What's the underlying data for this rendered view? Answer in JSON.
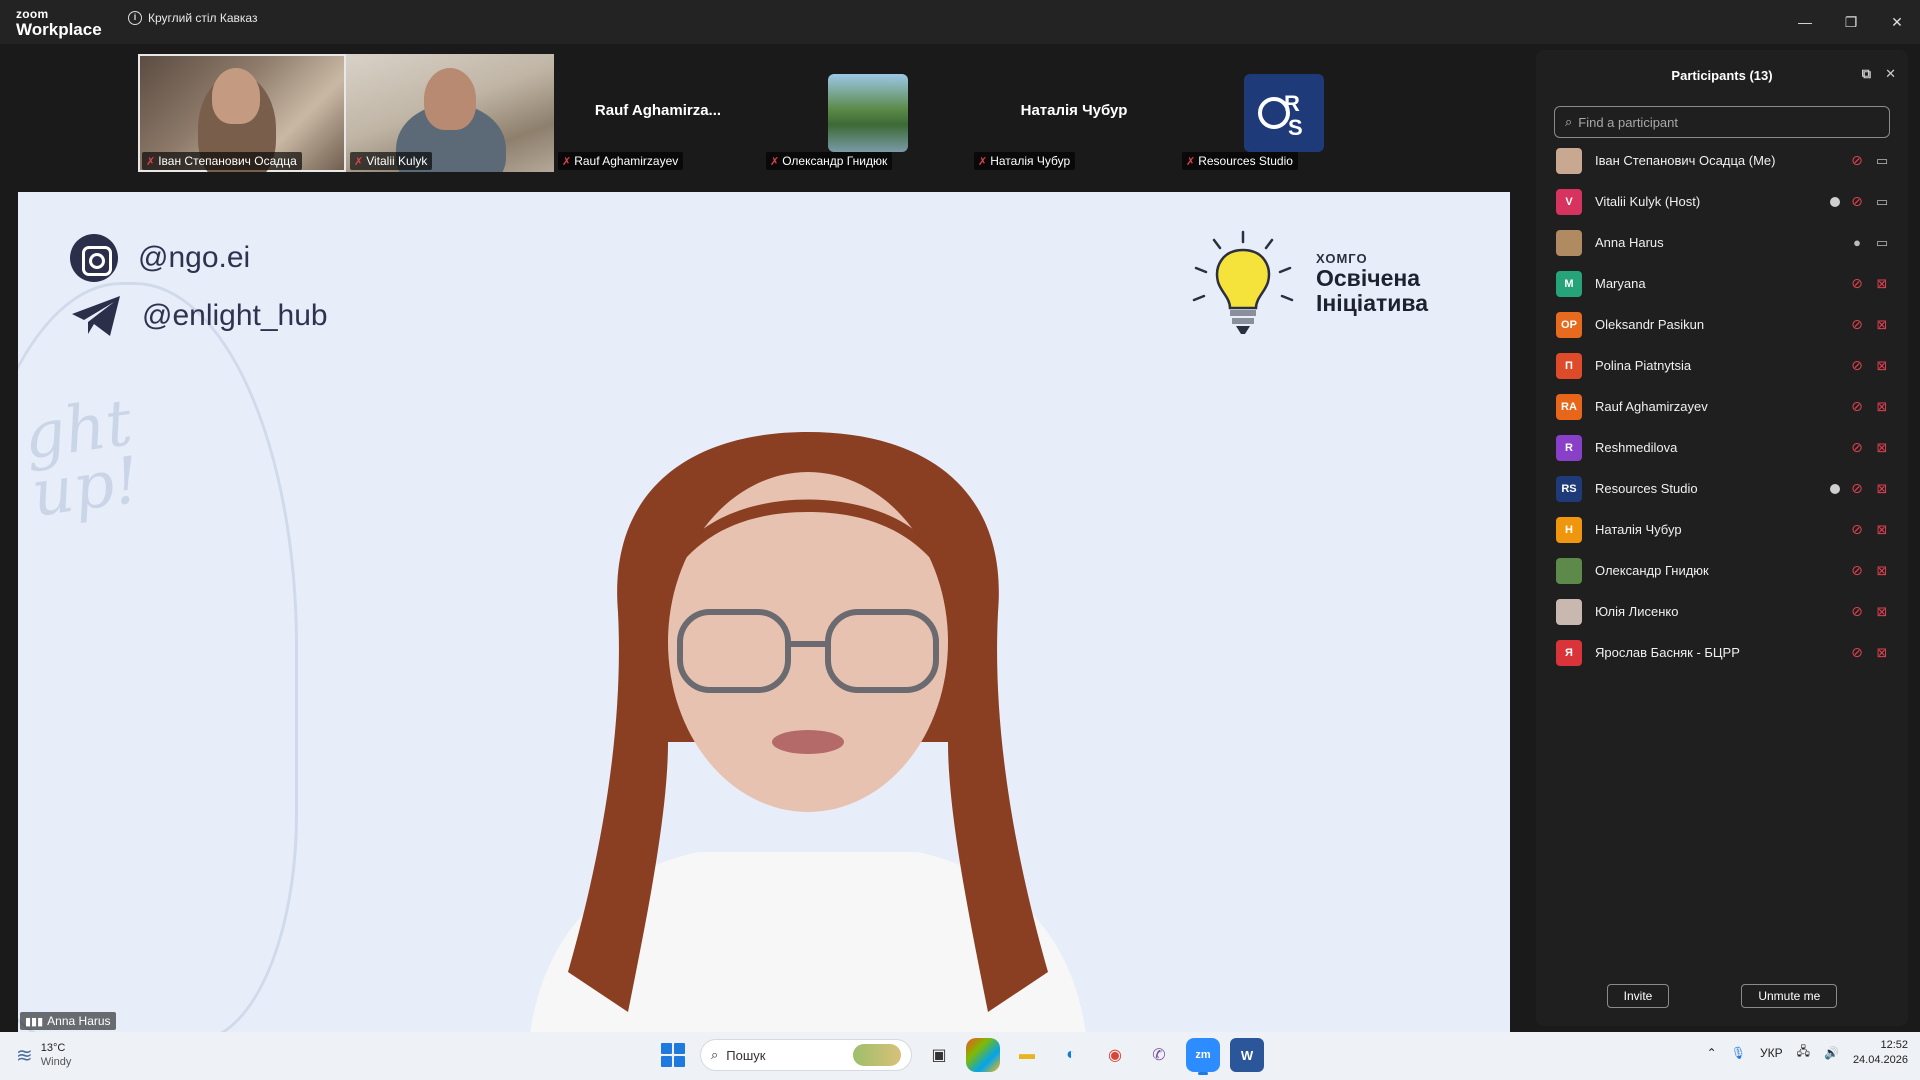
{
  "app": {
    "brand_top": "zoom",
    "brand_bottom": "Workplace",
    "meeting_title": "Круглий стіл Кавказ"
  },
  "window_controls": {
    "minimize": "—",
    "restore": "❐",
    "close": "✕"
  },
  "thumbnails": [
    {
      "name": "Іван Степанович Осадца",
      "type": "video"
    },
    {
      "name": "Vitalii Kulyk",
      "type": "video"
    },
    {
      "name": "Rauf Aghamirzayev",
      "display": "Rauf Aghamirza...",
      "type": "name"
    },
    {
      "name": "Олександр Гнидюк",
      "type": "avatar"
    },
    {
      "name": "Наталія Чубур",
      "display": "Наталія Чубур",
      "type": "name"
    },
    {
      "name": "Resources Studio",
      "type": "logo"
    }
  ],
  "main_video": {
    "instagram": "@ngo.ei",
    "telegram": "@enlight_hub",
    "logo_small": "ХОМГО",
    "logo_line1": "Освічена",
    "logo_line2": "Ініціатива",
    "bulb_text_1": "ght",
    "bulb_text_2": "up!",
    "speaker_name": "Anna Harus"
  },
  "panel": {
    "title": "Participants (13)",
    "search_placeholder": "Find a participant",
    "participants": [
      {
        "name": "Іван Степанович Осадца (Me)",
        "initials": "",
        "color": "#c8a890",
        "dot": false,
        "mic": "off",
        "cam": "on"
      },
      {
        "name": "Vitalii Kulyk (Host)",
        "initials": "V",
        "color": "#d6335e",
        "dot": true,
        "mic": "off",
        "cam": "on"
      },
      {
        "name": "Anna Harus",
        "initials": "",
        "color": "#b08a60",
        "dot": false,
        "mic": "on",
        "cam": "on"
      },
      {
        "name": "Maryana",
        "initials": "M",
        "color": "#27a37a",
        "dot": false,
        "mic": "off",
        "cam": "off"
      },
      {
        "name": "Oleksandr Pasikun",
        "initials": "OP",
        "color": "#e86a1e",
        "dot": false,
        "mic": "off",
        "cam": "off"
      },
      {
        "name": "Polina Piatnytsia",
        "initials": "П",
        "color": "#dd4b2a",
        "dot": false,
        "mic": "off",
        "cam": "off"
      },
      {
        "name": "Rauf Aghamirzayev",
        "initials": "RA",
        "color": "#e8661a",
        "dot": false,
        "mic": "off",
        "cam": "off"
      },
      {
        "name": "Reshmedilova",
        "initials": "R",
        "color": "#8a3fc9",
        "dot": false,
        "mic": "off",
        "cam": "off"
      },
      {
        "name": "Resources Studio",
        "initials": "RS",
        "color": "#1e3a78",
        "dot": true,
        "mic": "off",
        "cam": "off"
      },
      {
        "name": "Наталія Чубур",
        "initials": "Н",
        "color": "#f0960c",
        "dot": false,
        "mic": "off",
        "cam": "off"
      },
      {
        "name": "Олександр Гнидюк",
        "initials": "",
        "color": "#5d8a4a",
        "dot": false,
        "mic": "off",
        "cam": "off"
      },
      {
        "name": "Юлія Лисенко",
        "initials": "",
        "color": "#c9b8b0",
        "dot": false,
        "mic": "off",
        "cam": "off"
      },
      {
        "name": "Ярослав Басняк - БЦРР",
        "initials": "Я",
        "color": "#d9343a",
        "dot": false,
        "mic": "off",
        "cam": "off"
      }
    ],
    "invite": "Invite",
    "unmute": "Unmute me"
  },
  "taskbar": {
    "temp": "13°C",
    "weather": "Windy",
    "search_placeholder": "Пошук",
    "lang": "УКР",
    "time": "12:52",
    "date": "24.04.2026"
  }
}
